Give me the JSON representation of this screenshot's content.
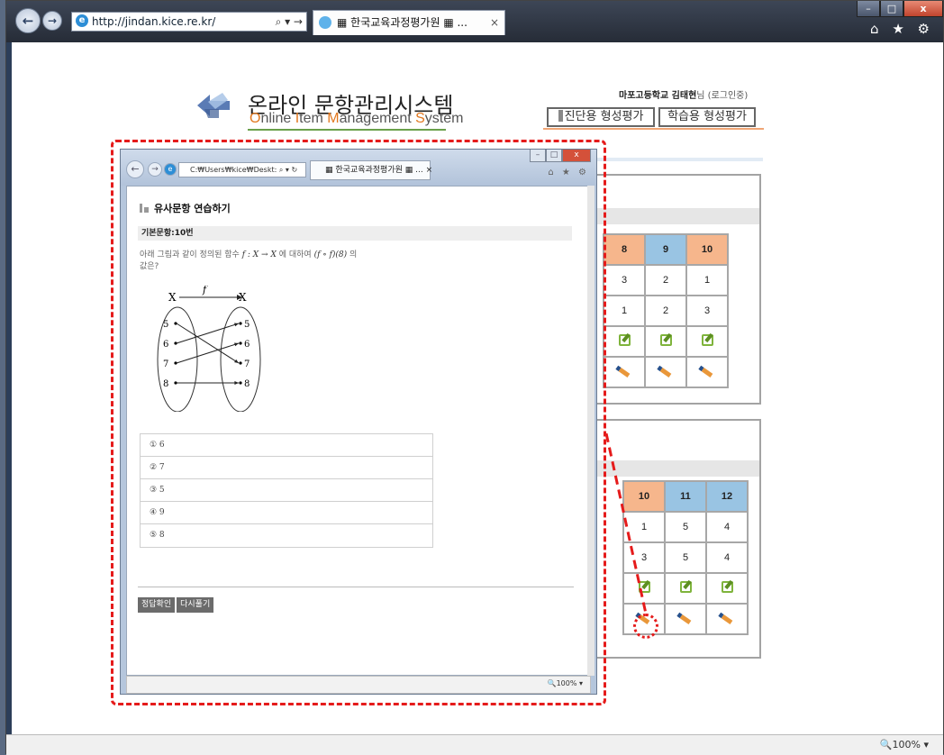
{
  "browser": {
    "back_icon": "arrow-left-icon",
    "forward_icon": "arrow-right-icon",
    "address": "http://jindan.kice.re.kr/",
    "address_tools": "⌕ ▾ →",
    "tab_title": "▦ 한국교육과정평가원 ▦ ...",
    "tab_close": "×",
    "toolbar_icons": "⌂ ★ ⚙",
    "zoom": "🔍100%  ▾"
  },
  "header": {
    "logo_title": "온라인 문항관리시스템",
    "logo_sub_parts": [
      {
        "accent": "O",
        "rest": "nline "
      },
      {
        "accent": "I",
        "rest": "tem "
      },
      {
        "accent": "M",
        "rest": "anagement "
      },
      {
        "accent": "S",
        "rest": "ystem"
      }
    ],
    "user_name": "마포고등학교 김태현",
    "user_suffix": "님 (로그인중)",
    "btn_diagnostic": "진단용 형성평가",
    "btn_learning": "학습용 형성평가"
  },
  "grid_top": {
    "headers": [
      "8",
      "9",
      "10"
    ],
    "rows": [
      [
        "3",
        "2",
        "1"
      ],
      [
        "1",
        "2",
        "3"
      ]
    ]
  },
  "grid_bottom": {
    "headers": [
      "10",
      "11",
      "12"
    ],
    "rows": [
      [
        "1",
        "5",
        "4"
      ],
      [
        "3",
        "5",
        "4"
      ]
    ]
  },
  "popup": {
    "address": "C:₩Users₩kice₩Deskt:",
    "address_tools": "⌕ ▾ ↻",
    "tab_title": "▦ 한국교육과정평가원 ▦ ...",
    "tab_close": "×",
    "toolbar_icons": "⌂ ★ ⚙",
    "title": "유사문항 연습하기",
    "base_item": "기본문항:10번",
    "question_pre": "아래 그림과 같이 정의된 함수",
    "question_math": "f : X → X",
    "question_mid": "에 대하여",
    "question_math2": "(f ∘ f)(8)",
    "question_post": "의",
    "question_line2": "값은?",
    "diagram": {
      "domain_label": "X",
      "codomain_label": "X",
      "func_label": "f",
      "domain": [
        "5",
        "6",
        "7",
        "8"
      ],
      "codomain": [
        "5",
        "6",
        "7",
        "8"
      ],
      "mapping": [
        [
          "5",
          "7"
        ],
        [
          "6",
          "5"
        ],
        [
          "7",
          "6"
        ],
        [
          "8",
          "8"
        ]
      ]
    },
    "choices": [
      "① 6",
      "② 7",
      "③ 5",
      "④ 9",
      "⑤ 8"
    ],
    "btn_check": "정답확인",
    "btn_retry": "다시풀기",
    "zoom": "🔍100%  ▾"
  },
  "colors": {
    "header_blue": "#99c4e3",
    "header_orange": "#f6b68c",
    "annotation_red": "#e51b1b",
    "accent_orange": "#e1771e",
    "accent_green": "#6aa04a"
  }
}
